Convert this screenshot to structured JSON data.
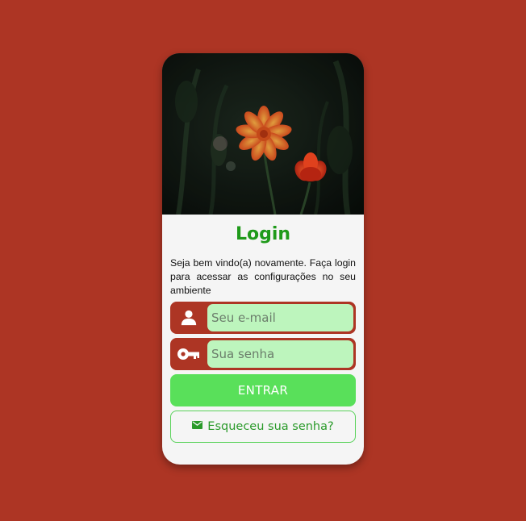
{
  "login": {
    "title": "Login",
    "description": "Seja bem vindo(a) novamente. Faça login para acessar as configurações no seu ambiente",
    "email_placeholder": "Seu e-mail",
    "password_placeholder": "Sua senha",
    "submit_label": "ENTRAR",
    "forgot_label": "Esqueceu sua senha?"
  },
  "icons": {
    "email": "user-icon",
    "password": "key-icon",
    "forgot": "mail-icon"
  },
  "colors": {
    "background": "#ad3524",
    "card": "#f5f5f5",
    "title": "#1f9a1a",
    "input_bg": "#bdf5bd",
    "button_bg": "#59e05a",
    "link_text": "#2a9a2a"
  }
}
